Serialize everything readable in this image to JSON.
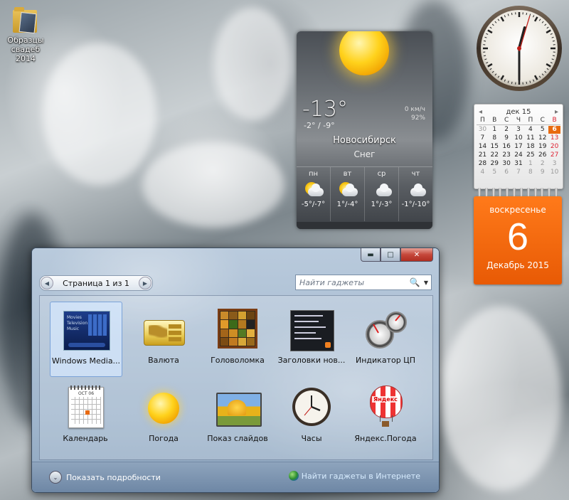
{
  "desktop": {
    "icon_label": "Образцы свадеб 2014"
  },
  "weather_gadget": {
    "temperature": "-13°",
    "range": "-2° / -9°",
    "wind": "0 км/ч",
    "humidity": "92%",
    "city": "Новосибирск",
    "condition": "Снег",
    "forecast": [
      {
        "day": "пн",
        "temps": "-5°/-7°",
        "icon": "partly-cloudy-icon"
      },
      {
        "day": "вт",
        "temps": "1°/-4°",
        "icon": "partly-cloudy-icon"
      },
      {
        "day": "ср",
        "temps": "1°/-3°",
        "icon": "cloudy-icon"
      },
      {
        "day": "чт",
        "temps": "-1°/-10°",
        "icon": "cloudy-icon"
      }
    ]
  },
  "clock_gadget": {
    "hour": 12,
    "minute": 30,
    "second": 3
  },
  "calendar_gadget": {
    "month_label": "дек 15",
    "prev": "◂",
    "next": "▸",
    "weekdays": [
      "П",
      "В",
      "С",
      "Ч",
      "П",
      "С",
      "В"
    ],
    "weeks": [
      [
        "30",
        "1",
        "2",
        "3",
        "4",
        "5",
        "6"
      ],
      [
        "7",
        "8",
        "9",
        "10",
        "11",
        "12",
        "13"
      ],
      [
        "14",
        "15",
        "16",
        "17",
        "18",
        "19",
        "20"
      ],
      [
        "21",
        "22",
        "23",
        "24",
        "25",
        "26",
        "27"
      ],
      [
        "28",
        "29",
        "30",
        "31",
        "1",
        "2",
        "3"
      ],
      [
        "4",
        "5",
        "6",
        "7",
        "8",
        "9",
        "10"
      ]
    ],
    "today_label": "6",
    "weekday_name": "воскресенье",
    "month_year": "Декабрь 2015"
  },
  "gallery_window": {
    "controls": {
      "minimize": "▬",
      "maximize": "□",
      "close": "✕"
    },
    "pager": {
      "text": "Страница 1 из 1",
      "prev": "◀",
      "next": "▶"
    },
    "search": {
      "placeholder": "Найти гаджеты",
      "icon": "🔍",
      "dropdown": "▼"
    },
    "gadgets_row1": [
      {
        "label": "Windows Media...",
        "icon": "media-center-icon",
        "selected": true
      },
      {
        "label": "Валюта",
        "icon": "currency-icon"
      },
      {
        "label": "Головоломка",
        "icon": "puzzle-icon"
      },
      {
        "label": "Заголовки нов...",
        "icon": "news-feed-icon"
      },
      {
        "label": "Индикатор ЦП",
        "icon": "cpu-meter-icon"
      }
    ],
    "gadgets_row2": [
      {
        "label": "Календарь",
        "icon": "calendar-icon"
      },
      {
        "label": "Погода",
        "icon": "weather-icon"
      },
      {
        "label": "Показ слайдов",
        "icon": "slideshow-icon"
      },
      {
        "label": "Часы",
        "icon": "clock-icon"
      },
      {
        "label": "Яндекс.Погода",
        "icon": "yandex-weather-icon"
      }
    ],
    "wmc_text": {
      "line1": "Movies",
      "line2": "Television",
      "line3": "Music"
    },
    "calendar_thumb_header": "OCT 06",
    "yandex_thumb_text": "Яндекс",
    "show_details": "Показать подробности",
    "show_details_icon": "⌄",
    "online_link": "Найти гаджеты в Интернете"
  },
  "colors": {
    "calendar_accent": "#e85a05",
    "window_frame": "#a9bed4",
    "link": "#d7ecff"
  }
}
